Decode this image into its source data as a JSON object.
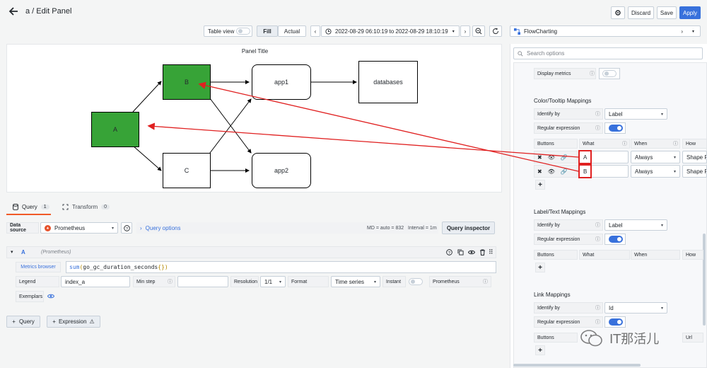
{
  "header": {
    "title": "a / Edit Panel",
    "discard": "Discard",
    "save": "Save",
    "apply": "Apply"
  },
  "toolbar": {
    "table_view": "Table view",
    "fill": "Fill",
    "actual": "Actual",
    "time_range": "2022-08-29 06:10:19 to 2022-08-29 18:10:19",
    "visualization": "FlowCharting"
  },
  "panel": {
    "title": "Panel Title",
    "nodes": {
      "a": "A",
      "b": "B",
      "c": "C",
      "app1": "app1",
      "app2": "app2",
      "databases": "databases"
    }
  },
  "tabs": {
    "query": "Query",
    "query_count": "1",
    "transform": "Transform",
    "transform_count": "0"
  },
  "datasource": {
    "label": "Data source",
    "value": "Prometheus",
    "query_options": "Query options",
    "md": "MD = auto = 832",
    "interval": "Interval = 1m",
    "inspector": "Query inspector"
  },
  "query_row": {
    "ref": "A",
    "ds": "(Prometheus)",
    "metrics_browser": "Metrics browser",
    "expr_fn": "sum",
    "expr_open": "(",
    "expr_metric": "go_gc_duration_seconds",
    "expr_braces": "{}",
    "expr_close": ")",
    "legend_label": "Legend",
    "legend_value": "index_a",
    "min_step": "Min step",
    "resolution_label": "Resolution",
    "resolution_value": "1/1",
    "format_label": "Format",
    "format_value": "Time series",
    "instant": "Instant",
    "prometheus": "Prometheus",
    "exemplars": "Exemplars"
  },
  "bottom_buttons": {
    "query": "Query",
    "expression": "Expression"
  },
  "options": {
    "search_placeholder": "Search options",
    "display_metrics": "Display metrics",
    "color_section": "Color/Tooltip Mappings",
    "identify_by": "Identify by",
    "identify_value_label": "Label",
    "regex": "Regular expression",
    "col_buttons": "Buttons",
    "col_what": "What",
    "col_when": "When",
    "col_how": "How",
    "rows": [
      {
        "what": "A",
        "when": "Always",
        "how": "Shape F"
      },
      {
        "what": "B",
        "when": "Always",
        "how": "Shape F"
      }
    ],
    "label_section": "Label/Text Mappings",
    "link_section": "Link Mappings",
    "identify_value_id": "Id",
    "col_url": "Url"
  },
  "watermark": "IT那活儿"
}
